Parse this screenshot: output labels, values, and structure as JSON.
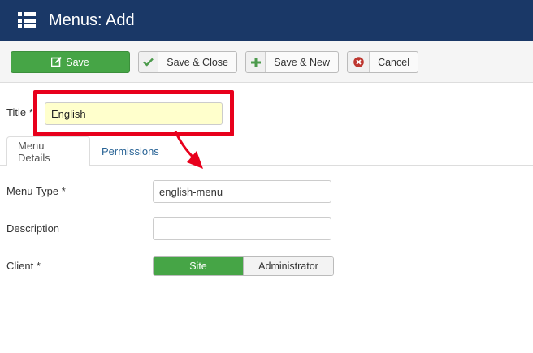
{
  "header": {
    "title": "Menus: Add",
    "icon": "list-menu-icon",
    "background": "#1a3867"
  },
  "toolbar": {
    "save_label": "Save",
    "save_close_label": "Save & Close",
    "save_new_label": "Save & New",
    "cancel_label": "Cancel",
    "save_color": "#46a546"
  },
  "form": {
    "title_label": "Title *",
    "title_value": "English",
    "tabs": [
      {
        "label": "Menu Details",
        "active": true
      },
      {
        "label": "Permissions",
        "active": false
      }
    ],
    "menu_type_label": "Menu Type *",
    "menu_type_value": "english-menu",
    "description_label": "Description",
    "description_value": "",
    "client_label": "Client *",
    "client_options": [
      "Site",
      "Administrator"
    ],
    "client_selected": "Site"
  },
  "annotation": {
    "highlight_color": "#e8001c"
  }
}
